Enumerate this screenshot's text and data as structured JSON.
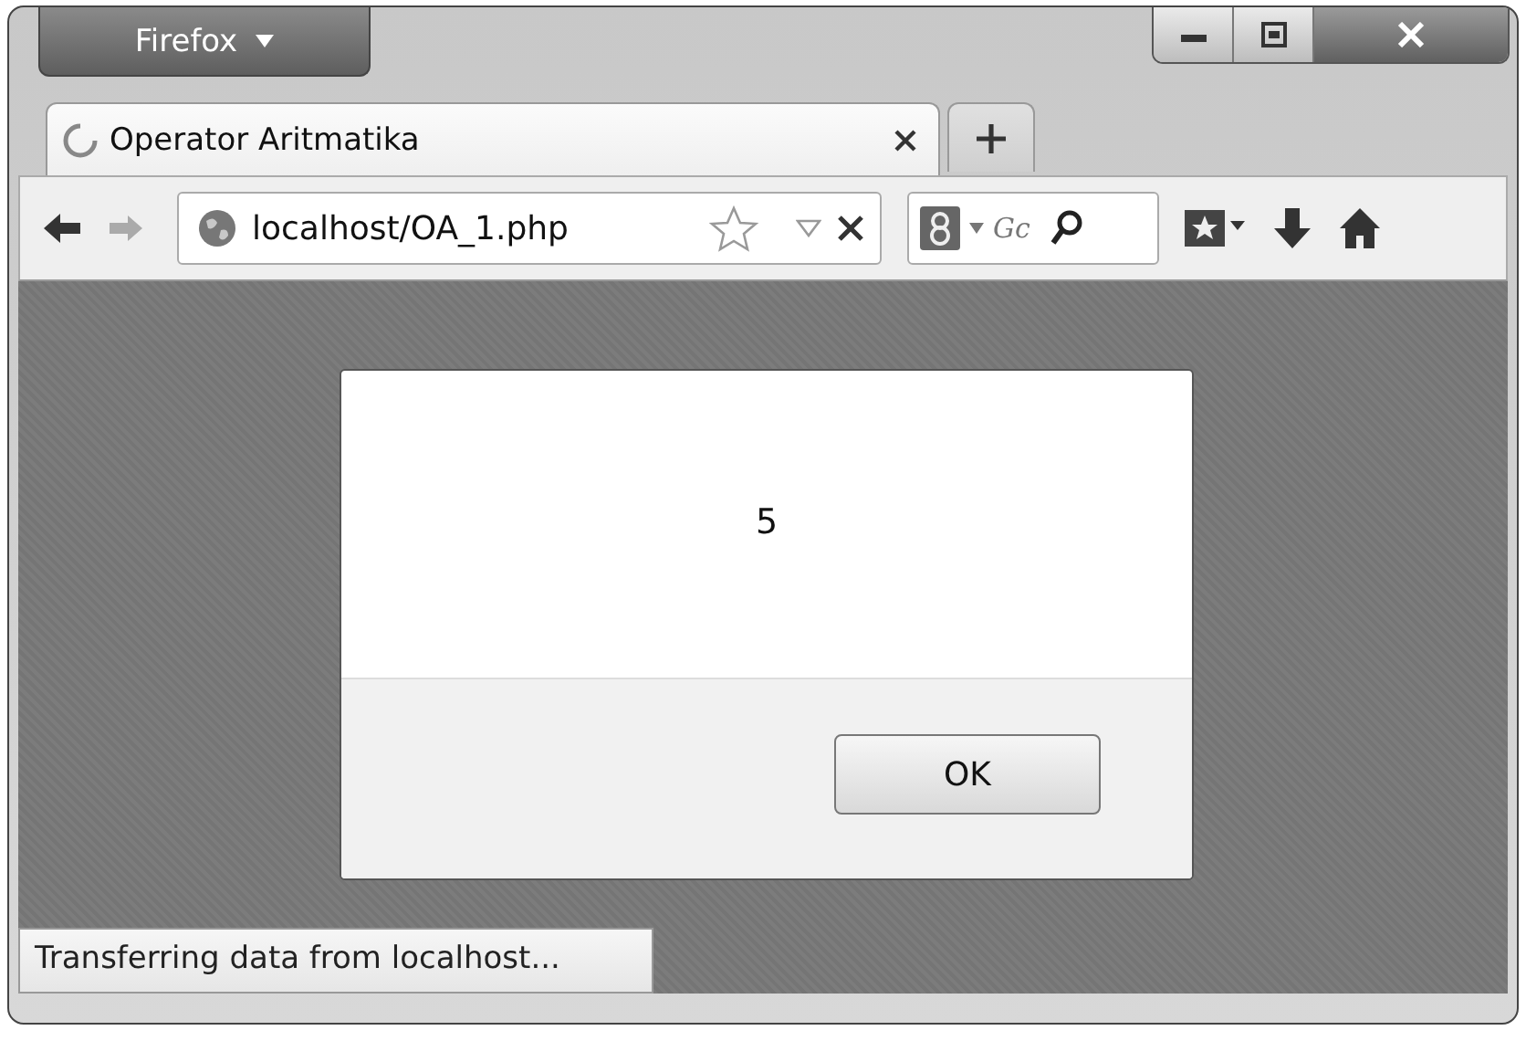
{
  "window": {
    "app_menu": "Firefox"
  },
  "tabs": [
    {
      "title": "Operator Aritmatika",
      "selected": true
    }
  ],
  "address_bar": {
    "url": "localhost/OA_1.php"
  },
  "search": {
    "placeholder": "Gc"
  },
  "dialog": {
    "message": "5",
    "button": "OK"
  },
  "status_bar": {
    "text": "Transferring data from localhost..."
  }
}
